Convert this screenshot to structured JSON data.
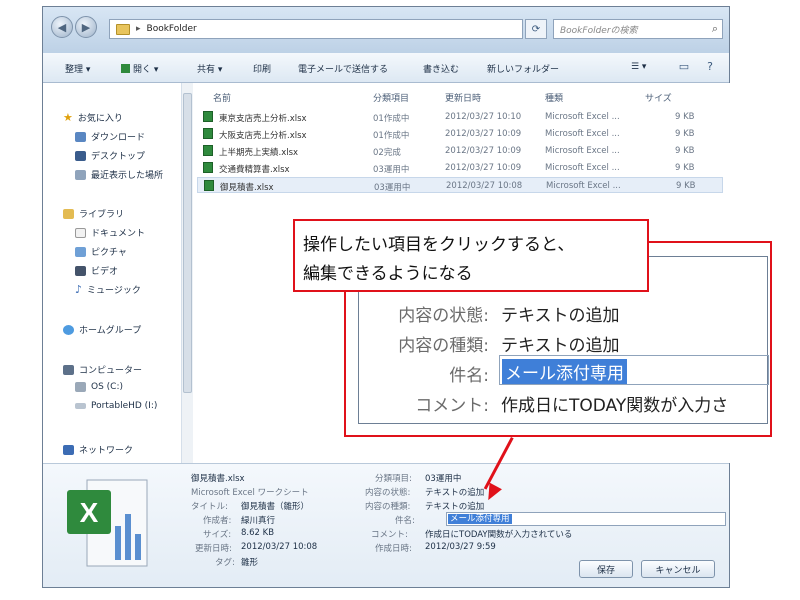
{
  "window": {
    "address_path": "BookFolder",
    "search_placeholder": "BookFolderの検索"
  },
  "toolbar": {
    "organize": "整理 ▾",
    "open": "開く ▾",
    "share": "共有 ▾",
    "print": "印刷",
    "email": "電子メールで送信する",
    "burn": "書き込む",
    "new_folder": "新しいフォルダー",
    "view_label": "☰ ▾"
  },
  "sidebar": {
    "favorites": "お気に入り",
    "fav_items": [
      "ダウンロード",
      "デスクトップ",
      "最近表示した場所"
    ],
    "libraries": "ライブラリ",
    "lib_items": [
      "ドキュメント",
      "ピクチャ",
      "ビデオ",
      "ミュージック"
    ],
    "homegroup": "ホームグループ",
    "computer": "コンピューター",
    "comp_items": [
      "OS (C:)",
      "PortableHD (I:)"
    ],
    "network": "ネットワーク"
  },
  "columns": [
    "名前",
    "分類項目",
    "更新日時",
    "種類",
    "サイズ"
  ],
  "files": [
    {
      "name": "東京支店売上分析.xlsx",
      "category": "01作成中",
      "date": "2012/03/27 10:10",
      "type": "Microsoft Excel ...",
      "size": "9 KB"
    },
    {
      "name": "大阪支店売上分析.xlsx",
      "category": "01作成中",
      "date": "2012/03/27 10:09",
      "type": "Microsoft Excel ...",
      "size": "9 KB"
    },
    {
      "name": "上半期売上実績.xlsx",
      "category": "02完成",
      "date": "2012/03/27 10:09",
      "type": "Microsoft Excel ...",
      "size": "9 KB"
    },
    {
      "name": "交通費精算書.xlsx",
      "category": "03運用中",
      "date": "2012/03/27 10:09",
      "type": "Microsoft Excel ...",
      "size": "9 KB"
    },
    {
      "name": "御見積書.xlsx",
      "category": "03運用中",
      "date": "2012/03/27 10:08",
      "type": "Microsoft Excel ...",
      "size": "9 KB"
    }
  ],
  "details": {
    "filename": "御見積書.xlsx",
    "filetype": "Microsoft Excel ワークシート",
    "left": [
      {
        "label": "タイトル:",
        "value": "御見積書（雛形）"
      },
      {
        "label": "作成者:",
        "value": "緑川真行"
      },
      {
        "label": "サイズ:",
        "value": "8.62 KB"
      },
      {
        "label": "更新日時:",
        "value": "2012/03/27 10:08"
      },
      {
        "label": "タグ:",
        "value": "雛形"
      }
    ],
    "right": [
      {
        "label": "分類項目:",
        "value": "03運用中"
      },
      {
        "label": "内容の状態:",
        "value": "テキストの追加"
      },
      {
        "label": "内容の種類:",
        "value": "テキストの追加"
      },
      {
        "label": "件名:",
        "value": "メール添付専用"
      },
      {
        "label": "コメント:",
        "value": "作成日にTODAY関数が入力されている"
      },
      {
        "label": "作成日時:",
        "value": "2012/03/27 9:59"
      }
    ],
    "save_button": "保存",
    "cancel_button": "キャンセル"
  },
  "zoom": {
    "rows": [
      {
        "label": "内容の状態:",
        "value": "テキストの追加"
      },
      {
        "label": "内容の種類:",
        "value": "テキストの追加"
      },
      {
        "label": "件名:",
        "value": "メール添付専用"
      },
      {
        "label": "コメント:",
        "value": "作成日にTODAY関数が入力さ"
      }
    ]
  },
  "callout": {
    "line1": "操作したい項目をクリックすると、",
    "line2": "編集できるようになる"
  },
  "colors": {
    "accent_red": "#e0111a",
    "selection_blue": "#3f7fd8",
    "excel_green": "#2f8a3d"
  }
}
